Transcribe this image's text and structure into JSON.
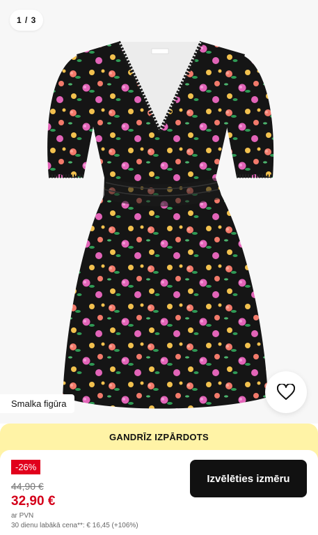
{
  "gallery": {
    "counter": "1 / 3",
    "fit_tag": "Smalka figūra",
    "wishlist_icon": "heart-outline-icon",
    "image_subject": "floral-dress"
  },
  "buybox": {
    "banner": "GANDRĪZ IZPĀRDOTS",
    "discount": "-26%",
    "old_price": "44,90 €",
    "new_price": "32,90 €",
    "vat": "ar PVN",
    "best_price": "30 dienu labākā cena**: € 16,45 (+106%)",
    "size_button": "Izvēlēties izmēru"
  },
  "colors": {
    "banner_bg": "#fff3a6",
    "discount_bg": "#e1001c",
    "price_red": "#d4001a",
    "button_bg": "#111111"
  }
}
